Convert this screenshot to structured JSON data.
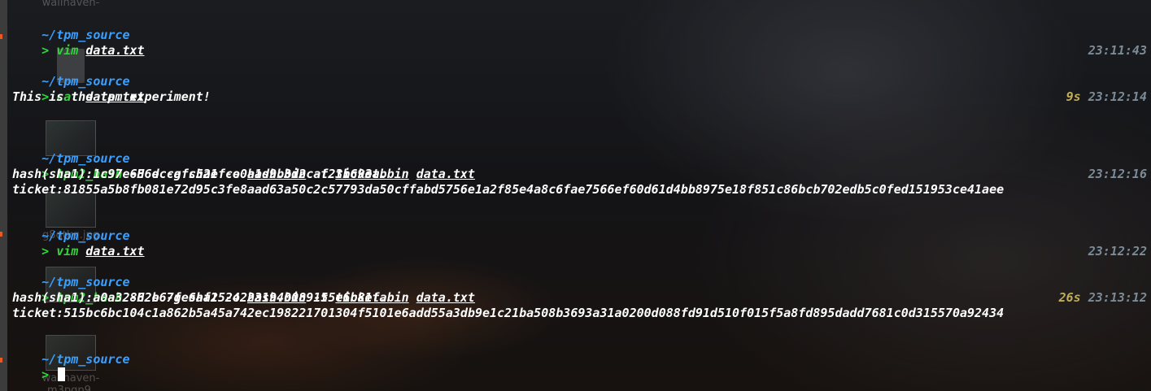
{
  "desktop_icons": [
    {
      "label": "wallhaven-",
      "kind": "image"
    },
    {
      "label": "g8qtkq.jpg",
      "kind": "image"
    },
    {
      "label": "wallhaven-",
      "kind": "image"
    },
    {
      "label": "m3pqp9.",
      "kind": "image"
    }
  ],
  "prompt_cwd_prefix": "~/",
  "prompt_cwd_name": "tpm_source",
  "prompt_symbol": ">",
  "blocks": [
    {
      "time": "23:11:43",
      "duration": "",
      "command": "vim",
      "args": [
        "data.txt"
      ],
      "output": []
    },
    {
      "time": "23:12:14",
      "duration": "9s",
      "command": "cat",
      "args": [
        "data.txt"
      ],
      "output": [
        "This is the tpm experiment!",
        ""
      ]
    },
    {
      "time": "23:12:16",
      "duration": "",
      "command": "tpm2_hash",
      "command_line": "-H e -g sha1 -o hash.bin -t ticket.bin data.txt",
      "output": [
        "hash(sha1):1c97e686dccafc52efce0a1d9b3d2caf23b693ab",
        "ticket:81855a5b8fb081e72d95c3fe8aad63a50c2c57793da50cffabd5756e1a2f85e4a8c6fae7566ef60d61d4bb8975e18f851c86bcb702edb5c0fed151953ce41aee"
      ]
    },
    {
      "time": "23:12:22",
      "duration": "",
      "command": "vim",
      "args": [
        "data.txt"
      ],
      "output": []
    },
    {
      "time": "23:13:12",
      "duration": "26s",
      "command": "tpm2_hash",
      "command_line": "-H e -g sha1 -o hash.bin -t ticket.bin data.txt",
      "output": [
        "hash(sha1):a0a32862b67fe6af25242231940089155e6b81fa",
        "ticket:515bc6bc104c1a862b5a45a742ec198221701304f5101e6add55a3db9e1c21ba508b3693a31a0200d088fd91d510f015f5a8fd895dadd7681c0d315570a92434"
      ]
    }
  ],
  "tpm_tokens": {
    "flag1": "-H e -g sha1 -o",
    "hash_file": "hash.bin",
    "flag2": "-t",
    "ticket_file": "ticket.bin",
    "data_file": "data.txt"
  },
  "colors": {
    "cwd": "#1fb6ff",
    "prompt": "#2fd63c",
    "command": "#37d13f",
    "time": "#7b8b97",
    "duration": "#c1ae59",
    "text": "#ffffff"
  }
}
